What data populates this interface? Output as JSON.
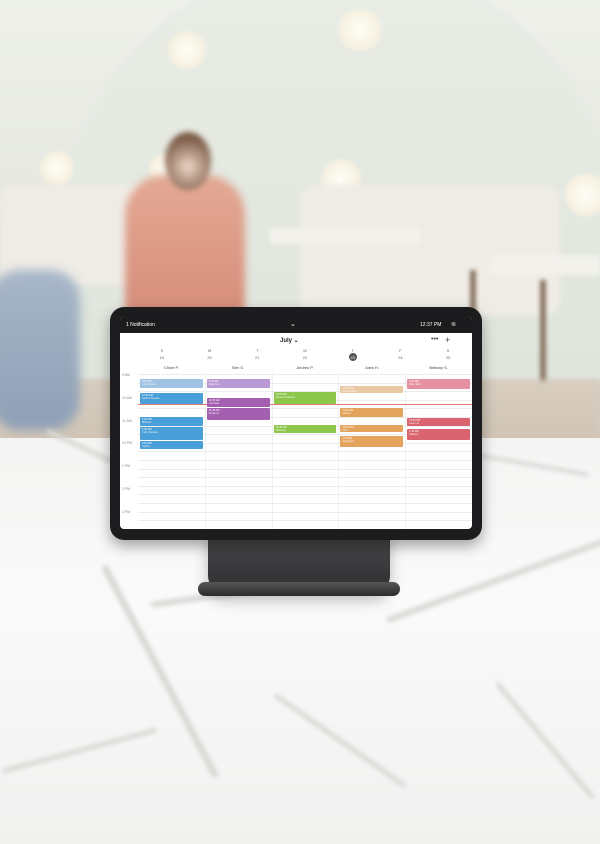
{
  "statusbar": {
    "notification": "1 Notification",
    "chevron": "⌄",
    "time": "12:37 PM",
    "wifi": "≋"
  },
  "calendar": {
    "month": "July ⌄",
    "more": "•••",
    "add": "+",
    "weekdays": [
      "S",
      "M",
      "T",
      "W",
      "T",
      "F",
      "S"
    ],
    "days": [
      "19",
      "20",
      "21",
      "22",
      "23",
      "24",
      "25"
    ],
    "today_index": 4,
    "staff": [
      "Chloe P.",
      "Ben S.",
      "Andres P.",
      "Jules H.",
      "Brittany S."
    ],
    "times": [
      "9 AM",
      "10 AM",
      "11 AM",
      "12 PM",
      "1 PM",
      "2 PM",
      "3 PM"
    ]
  },
  "colors": {
    "blue": "#4a9fd8",
    "light_blue": "#9ec3e3",
    "purple": "#a55fb0",
    "lavender": "#b99ad4",
    "green": "#8cc64a",
    "tan": "#e9c8a4",
    "orange": "#e3a35d",
    "pink": "#e691a2",
    "red": "#d9636f"
  },
  "events": [
    {
      "col": 0,
      "row": 0.6,
      "len": 1.0,
      "color": "light_blue",
      "t1": "9:30 AM",
      "t2": "Client Name"
    },
    {
      "col": 0,
      "row": 2.2,
      "len": 1.3,
      "color": "blue",
      "t1": "10:30 AM",
      "t2": "Haircut Service"
    },
    {
      "col": 0,
      "row": 5.0,
      "len": 1.0,
      "color": "blue",
      "t1": "1:00 PM",
      "t2": "Blowout"
    },
    {
      "col": 0,
      "row": 6.2,
      "len": 1.5,
      "color": "blue",
      "t1": "1:30 PM",
      "t2": "Color Session"
    },
    {
      "col": 0,
      "row": 7.8,
      "len": 0.9,
      "color": "blue",
      "t1": "2:15 PM",
      "t2": "Styling"
    },
    {
      "col": 1,
      "row": 0.6,
      "len": 1.0,
      "color": "lavender",
      "t1": "9:30 AM",
      "t2": "Manicure"
    },
    {
      "col": 1,
      "row": 2.8,
      "len": 1.0,
      "color": "purple",
      "t1": "10:45 AM",
      "t2": "Gel Nails"
    },
    {
      "col": 1,
      "row": 4.0,
      "len": 1.3,
      "color": "purple",
      "t1": "11:15 AM",
      "t2": "Pedicure"
    },
    {
      "col": 2,
      "row": 2.1,
      "len": 1.4,
      "color": "green",
      "t1": "10:15 AM",
      "t2": "Facial Treatment"
    },
    {
      "col": 2,
      "row": 5.9,
      "len": 1.0,
      "color": "green",
      "t1": "12:45 PM",
      "t2": "Massage"
    },
    {
      "col": 3,
      "row": 1.4,
      "len": 0.8,
      "color": "tan",
      "t1": "10:00 AM",
      "t2": "Consultation"
    },
    {
      "col": 3,
      "row": 4.0,
      "len": 1.0,
      "color": "orange",
      "t1": "11:30 AM",
      "t2": "Haircut"
    },
    {
      "col": 3,
      "row": 5.9,
      "len": 0.8,
      "color": "orange",
      "t1": "12:45 PM",
      "t2": "Trim"
    },
    {
      "col": 3,
      "row": 7.2,
      "len": 1.3,
      "color": "orange",
      "t1": "1:45 PM",
      "t2": "Highlights"
    },
    {
      "col": 4,
      "row": 0.6,
      "len": 1.2,
      "color": "pink",
      "t1": "9:30 AM",
      "t2": "Brow Wax"
    },
    {
      "col": 4,
      "row": 5.1,
      "len": 1.0,
      "color": "red",
      "t1": "12:15 PM",
      "t2": "Lash Lift"
    },
    {
      "col": 4,
      "row": 6.4,
      "len": 1.3,
      "color": "red",
      "t1": "1:15 PM",
      "t2": "Makeup"
    }
  ]
}
